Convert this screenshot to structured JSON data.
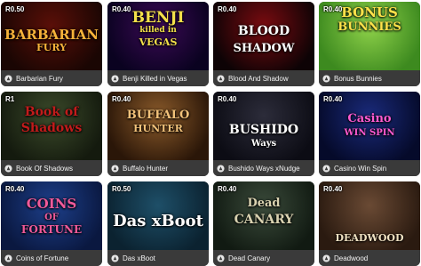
{
  "games": [
    {
      "bet": "R0.50",
      "name": "Barbarian Fury",
      "art": {
        "lines": [
          "BARBARIAN",
          "FURY"
        ]
      },
      "colors": {
        "bg1": "#5a0f08",
        "bg2": "#1a0603",
        "fg": "#f6b23a"
      }
    },
    {
      "bet": "R0.40",
      "name": "Benji Killed in Vegas",
      "art": {
        "lines": [
          "BENJI",
          "killed in",
          "VEGAS"
        ]
      },
      "colors": {
        "bg1": "#3b0a55",
        "bg2": "#0a0220",
        "fg": "#f3e04a"
      }
    },
    {
      "bet": "R0.40",
      "name": "Blood And Shadow",
      "art": {
        "lines": [
          "BLOOD",
          "SHADOW"
        ]
      },
      "colors": {
        "bg1": "#7a0b10",
        "bg2": "#0d0305",
        "fg": "#ffffff"
      }
    },
    {
      "bet": "R0.40",
      "name": "Bonus Bunnies",
      "art": {
        "lines": [
          "BONUS",
          "BUNNIES"
        ]
      },
      "colors": {
        "bg1": "#8fd24a",
        "bg2": "#3d8a1f",
        "fg": "#ffe24a"
      }
    },
    {
      "bet": "R1",
      "name": "Book Of Shadows",
      "art": {
        "lines": [
          "Book of",
          "Shadows"
        ]
      },
      "colors": {
        "bg1": "#3b4a2a",
        "bg2": "#141a0e",
        "fg": "#c21b1b"
      }
    },
    {
      "bet": "R0.40",
      "name": "Buffalo Hunter",
      "art": {
        "lines": [
          "BUFFALO",
          "HUNTER"
        ]
      },
      "colors": {
        "bg1": "#8a5a2a",
        "bg2": "#2a1608",
        "fg": "#f2c27a"
      }
    },
    {
      "bet": "R0.40",
      "name": "Bushido Ways xNudge",
      "art": {
        "lines": [
          "BUSHIDO",
          "Ways"
        ]
      },
      "colors": {
        "bg1": "#2c2c3a",
        "bg2": "#0c0c14",
        "fg": "#ffffff"
      }
    },
    {
      "bet": "R0.40",
      "name": "Casino Win Spin",
      "art": {
        "lines": [
          "Casino",
          "WIN SPIN"
        ]
      },
      "colors": {
        "bg1": "#1a2a7a",
        "bg2": "#050a2a",
        "fg": "#ff5ad0"
      }
    },
    {
      "bet": "R0.40",
      "name": "Coins of Fortune",
      "art": {
        "lines": [
          "COINS",
          "OF",
          "FORTUNE"
        ]
      },
      "colors": {
        "bg1": "#1d3f8a",
        "bg2": "#0a1840",
        "fg": "#f05a9a"
      }
    },
    {
      "bet": "R0.50",
      "name": "Das xBoot",
      "art": {
        "lines": [
          "Das xBoot"
        ]
      },
      "colors": {
        "bg1": "#1e4f68",
        "bg2": "#0b2230",
        "fg": "#ffffff"
      }
    },
    {
      "bet": "R0.40",
      "name": "Dead Canary",
      "art": {
        "lines": [
          "Dead",
          "CANARY"
        ]
      },
      "colors": {
        "bg1": "#3a4a3a",
        "bg2": "#111a12",
        "fg": "#d9d2b0"
      }
    },
    {
      "bet": "R0.40",
      "name": "Deadwood",
      "art": {
        "lines": [
          "DEADWOOD"
        ]
      },
      "colors": {
        "bg1": "#6a4a34",
        "bg2": "#2a1a10",
        "fg": "#f0e2c2"
      }
    }
  ]
}
